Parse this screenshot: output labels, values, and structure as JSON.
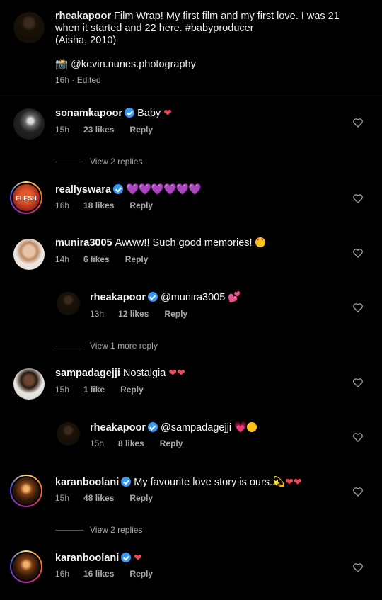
{
  "caption": {
    "username": "rheakapoor",
    "text": "Film Wrap! My first film and my first love. I was 21 when it started and 22 here. #babyproducer",
    "text2": "(Aisha, 2010)",
    "camera_icon": "📸",
    "credit": "@kevin.nunes.photography",
    "time": "16h",
    "edited": "Edited"
  },
  "comments": [
    {
      "username": "sonamkapoor",
      "verified": true,
      "text": "Baby",
      "time": "15h",
      "likes": "23 likes",
      "reply": "Reply"
    },
    {
      "username": "reallyswara",
      "verified": true,
      "text": "",
      "time": "16h",
      "likes": "18 likes",
      "reply": "Reply",
      "avatar_text": "FLESH"
    },
    {
      "username": "munira3005",
      "verified": false,
      "text": "Awww!! Such good memories!",
      "time": "14h",
      "likes": "6 likes",
      "reply": "Reply"
    },
    {
      "username": "rheakapoor",
      "verified": true,
      "text": "@munira3005",
      "time": "13h",
      "likes": "12 likes",
      "reply": "Reply"
    },
    {
      "username": "sampadagejji",
      "verified": false,
      "text": "Nostalgia",
      "time": "15h",
      "likes": "1 like",
      "reply": "Reply"
    },
    {
      "username": "rheakapoor",
      "verified": true,
      "text": "@sampadagejji",
      "time": "15h",
      "likes": "8 likes",
      "reply": "Reply"
    },
    {
      "username": "karanboolani",
      "verified": true,
      "text": "My favourite love story is ours.",
      "time": "15h",
      "likes": "48 likes",
      "reply": "Reply"
    },
    {
      "username": "karanboolani",
      "verified": true,
      "text": "",
      "time": "16h",
      "likes": "16 likes",
      "reply": "Reply"
    }
  ],
  "view_replies": [
    "View 2 replies",
    "View 1 more reply",
    "View 2 replies"
  ],
  "colors": {
    "background": "#000000",
    "meta": "#a8a8a8",
    "verified": "#3897f0",
    "heart": "#ed4956"
  }
}
